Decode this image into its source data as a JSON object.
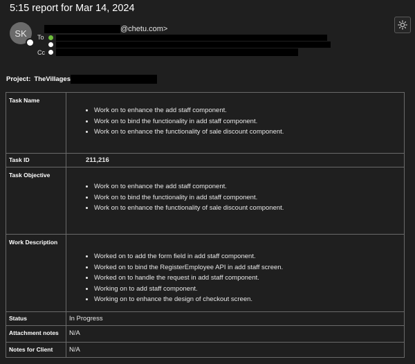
{
  "subject": "5:15 report for Mar 14, 2024",
  "sender": {
    "initials": "SK",
    "email_domain": "@chetu.com>"
  },
  "recipients": {
    "to_label": "To",
    "cc_label": "Cc"
  },
  "project": {
    "label": "Project:",
    "name": "TheVillages"
  },
  "report": {
    "task_name": {
      "label": "Task Name",
      "items": [
        "Work on to enhance the add staff component.",
        "Work on to bind the functionality in add staff component.",
        "Work on to enhance the functionality of sale discount component."
      ]
    },
    "task_id": {
      "label": "Task ID",
      "value": "211,216"
    },
    "task_objective": {
      "label": "Task Objective",
      "items": [
        "Work on to enhance the add staff component.",
        "Work on to bind the functionality in add staff component.",
        "Work on to enhance the functionality of sale discount component."
      ]
    },
    "work_description": {
      "label": "Work Description",
      "items": [
        "Worked on to add the form field in add staff component.",
        "Worked on to bind the RegisterEmployee API in add staff screen.",
        "Worked on to handle the request in add staff component.",
        "Working on to add staff component.",
        "Working on to enhance the design of checkout screen."
      ]
    },
    "status": {
      "label": "Status",
      "value": "In Progress"
    },
    "attachment_notes": {
      "label": "Attachment notes",
      "value": "N/A"
    },
    "notes_for_client": {
      "label": "Notes for Client",
      "value": "N/A"
    }
  },
  "icons": {
    "theme_toggle": "sun-icon"
  }
}
